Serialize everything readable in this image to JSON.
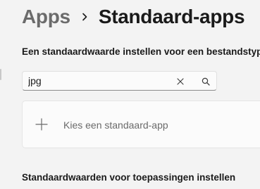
{
  "breadcrumb": {
    "parent": "Apps",
    "separator_icon": "chevron-right-icon",
    "current": "Standaard-apps"
  },
  "file_type_section": {
    "label": "Een standaardwaarde instellen voor een bestandstype",
    "search": {
      "value": "jpg",
      "clear_icon": "close-icon",
      "search_icon": "search-icon"
    },
    "choose_default": {
      "icon": "plus-icon",
      "label": "Kies een standaard-app"
    }
  },
  "apps_section": {
    "heading": "Standaardwaarden voor toepassingen instellen"
  },
  "colors": {
    "background": "#f3f3f3",
    "card": "#fbfbfb",
    "text": "#1a1a1a",
    "muted_text": "#6b6b6b"
  }
}
